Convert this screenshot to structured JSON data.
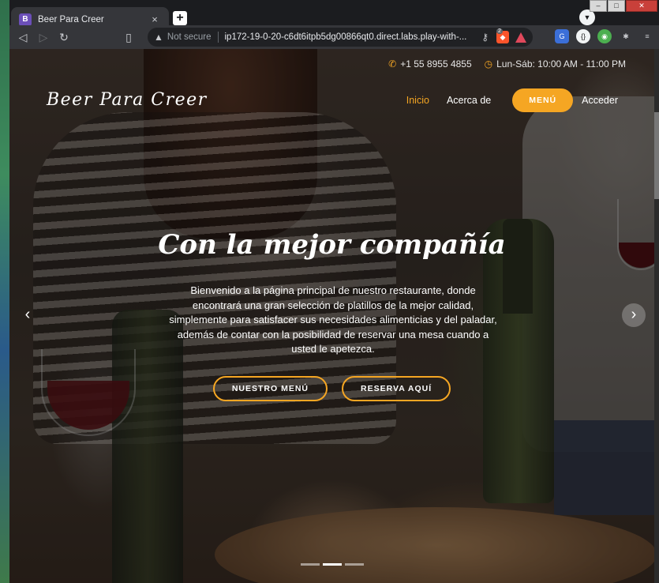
{
  "browser": {
    "tab_title": "Beer Para Creer",
    "tab_favicon_letter": "B",
    "tab_close": "×",
    "new_tab": "+",
    "not_secure": "Not secure",
    "url": "ip172-19-0-20-c6dt6itpb5dg00866qt0.direct.labs.play-with-...",
    "brave_badge": "2",
    "icons": [
      "back-icon",
      "forward-icon",
      "reload-icon",
      "bookmark-icon",
      "warning-icon",
      "key-icon",
      "brave-shield-icon",
      "brave-rewards-icon",
      "translate-icon",
      "extension-icon",
      "puzzle-icon",
      "menu-icon"
    ]
  },
  "info": {
    "phone": "+1 55 8955 4855",
    "hours": "Lun-Sáb: 10:00 AM - 11:00 PM"
  },
  "navbar": {
    "logo": "Beer Para Creer",
    "links": {
      "home": "Inicio",
      "about": "Acerca de",
      "menu": "MENÚ",
      "login": "Acceder"
    }
  },
  "hero": {
    "title": "Con la mejor compañía",
    "text": "Bienvenido a la página principal de nuestro restaurante, donde encontrará una gran selección de platillos de la mejor calidad, simplemente para satisfacer sus necesidades alimenticias y del paladar, además de contar con la posibilidad de reservar una mesa cuando a usted le apetezca.",
    "button_menu": "NUESTRO MENÚ",
    "button_reserve": "RESERVA AQUÍ",
    "prev_arrow": "‹",
    "next_arrow": "›"
  },
  "carousel": {
    "slides": 3,
    "active": 2
  },
  "colors": {
    "accent": "#f5a623",
    "browser_bg": "#35363a"
  }
}
